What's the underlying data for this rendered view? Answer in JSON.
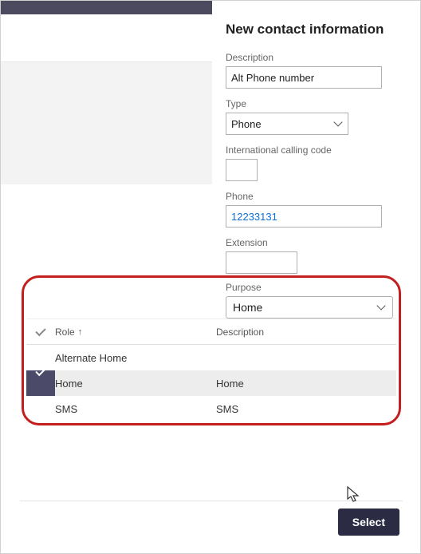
{
  "panel": {
    "title": "New contact information",
    "description": {
      "label": "Description",
      "value": "Alt Phone number"
    },
    "type": {
      "label": "Type",
      "value": "Phone"
    },
    "intlCode": {
      "label": "International calling code",
      "value": ""
    },
    "phone": {
      "label": "Phone",
      "value": "12233131"
    },
    "extension": {
      "label": "Extension",
      "value": ""
    },
    "purpose": {
      "label": "Purpose",
      "value": "Home"
    }
  },
  "dropdown": {
    "columns": {
      "role": "Role",
      "description": "Description"
    },
    "rows": [
      {
        "role": "Alternate Home",
        "description": "",
        "selected": false
      },
      {
        "role": "Home",
        "description": "Home",
        "selected": true
      },
      {
        "role": "SMS",
        "description": "SMS",
        "selected": false
      }
    ]
  },
  "footer": {
    "select": "Select"
  }
}
